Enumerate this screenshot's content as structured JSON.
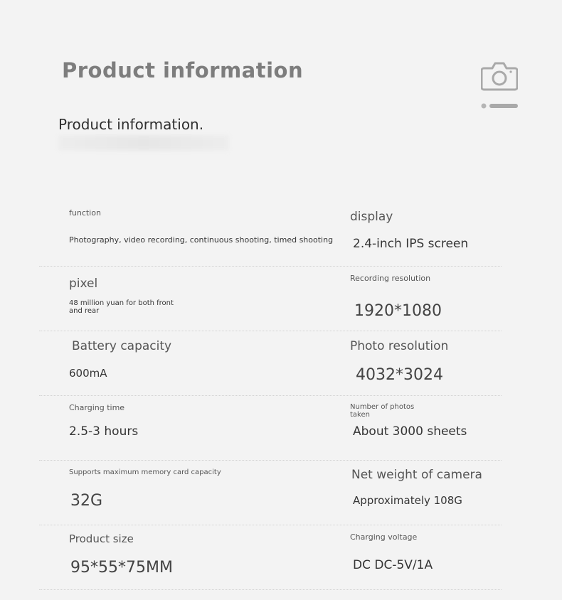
{
  "header": {
    "title": "Product information",
    "subtitle": "Product information."
  },
  "icons": {
    "top_right": "camera-icon",
    "indicator": "carousel-dots"
  },
  "specs": [
    {
      "left": {
        "label": "function",
        "value": "Photography, video recording, continuous shooting, timed shooting"
      },
      "right": {
        "label": "display",
        "value": "2.4-inch IPS screen"
      }
    },
    {
      "left": {
        "label": "pixel",
        "value": "48 million yuan for both front and rear"
      },
      "right": {
        "label": "Recording resolution",
        "value": "1920*1080"
      }
    },
    {
      "left": {
        "label": "Battery capacity",
        "value": "600mA"
      },
      "right": {
        "label": "Photo resolution",
        "value": "4032*3024"
      }
    },
    {
      "left": {
        "label": "Charging time",
        "value": "2.5-3 hours"
      },
      "right": {
        "label": "Number of photos taken",
        "value": "About 3000 sheets"
      }
    },
    {
      "left": {
        "label": "Supports maximum memory card capacity",
        "value": "32G"
      },
      "right": {
        "label": "Net weight of camera",
        "value": "Approximately 108G"
      }
    },
    {
      "left": {
        "label": "Product size",
        "value": "95*55*75MM"
      },
      "right": {
        "label": "Charging voltage",
        "value": "DC DC-5V/1A"
      }
    }
  ]
}
